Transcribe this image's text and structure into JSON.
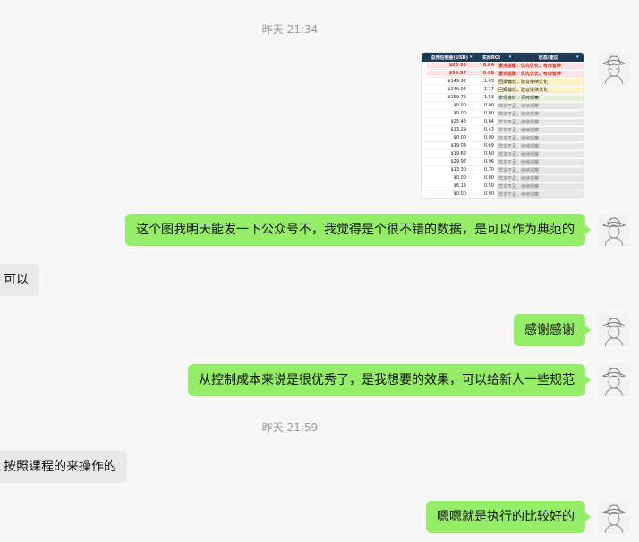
{
  "timestamps": [
    "昨天 21:34",
    "昨天 21:59"
  ],
  "messages": [
    {
      "from": "me",
      "text": "这个图我明天能发一下公众号不，我觉得是个很不错的数据，是可以作为典范的"
    },
    {
      "from": "other",
      "text": "可以"
    },
    {
      "from": "me",
      "text": "感谢感谢"
    },
    {
      "from": "me",
      "text": "从控制成本来说是很优秀了，是我想要的效果，可以给新人一些规范"
    },
    {
      "from": "other",
      "text": "按照课程的来操作的"
    },
    {
      "from": "me",
      "text": "嗯嗯就是执行的比较好的"
    }
  ],
  "image_table": {
    "headers": [
      "总预估佣金(USD)",
      "实际ROI",
      "状态/建议"
    ],
    "rows": [
      {
        "mark": "",
        "amount": "$23.98",
        "roi": "0.84",
        "status": "重点提醒：优先优化，考虑暂停",
        "tone": "red"
      },
      {
        "mark": "",
        "amount": "$59.97",
        "roi": "0.98",
        "status": "重点提醒：优先优化，考虑暂停",
        "tone": "red"
      },
      {
        "mark": "",
        "amount": "$149.92",
        "roi": "1.03",
        "status": "回报偏低，建议继续优化",
        "tone": "yellow"
      },
      {
        "mark": "",
        "amount": "$140.94",
        "roi": "1.17",
        "status": "回报偏低，建议继续优化",
        "tone": "yellow"
      },
      {
        "mark": "",
        "amount": "$159.76",
        "roi": "1.53",
        "status": "表现良好：保持观察",
        "tone": "green"
      },
      {
        "mark": "",
        "amount": "$0.00",
        "roi": "0.00",
        "status": "样本不足，继续观察",
        "tone": "gray"
      },
      {
        "mark": "",
        "amount": "$0.00",
        "roi": "0.00",
        "status": "样本不足，继续观察",
        "tone": "gray"
      },
      {
        "mark": "",
        "amount": "$25.43",
        "roi": "0.84",
        "status": "样本不足，继续观察",
        "tone": "gray"
      },
      {
        "mark": "",
        "amount": "$13.29",
        "roi": "0.43",
        "status": "样本不足，继续观察",
        "tone": "gray"
      },
      {
        "mark": "",
        "amount": "$0.00",
        "roi": "0.00",
        "status": "样本不足，继续观察",
        "tone": "gray"
      },
      {
        "mark": "",
        "amount": "$19.04",
        "roi": "0.69",
        "status": "样本不足，继续观察",
        "tone": "gray"
      },
      {
        "mark": "",
        "amount": "$19.62",
        "roi": "0.60",
        "status": "样本不足，继续观察",
        "tone": "gray"
      },
      {
        "mark": "",
        "amount": "$29.97",
        "roi": "0.96",
        "status": "样本不足，继续观察",
        "tone": "gray"
      },
      {
        "mark": "",
        "amount": "$13.30",
        "roi": "0.70",
        "status": "样本不足，继续观察",
        "tone": "gray"
      },
      {
        "mark": "",
        "amount": "$0.00",
        "roi": "0.00",
        "status": "样本不足，继续观察",
        "tone": "gray"
      },
      {
        "mark": "",
        "amount": "$6.19",
        "roi": "0.50",
        "status": "样本不足，继续观察",
        "tone": "gray"
      },
      {
        "mark": "",
        "amount": "$0.00",
        "roi": "0.00",
        "status": "样本不足，继续观察",
        "tone": "gray"
      },
      {
        "mark": "",
        "amount": "$0.00",
        "roi": "0.00",
        "status": "样本不足，继续观察",
        "tone": "gray"
      }
    ]
  },
  "colors": {
    "bubble_me": "#95ec69",
    "bubble_other": "#e9e9e9",
    "tone_red": "#fde3e3",
    "tone_yellow": "#fff3c4",
    "tone_green": "#e4f4d8",
    "tone_gray": "#e6e6e6"
  },
  "icons": {
    "avatar": "cowboy-sketch-avatar"
  }
}
